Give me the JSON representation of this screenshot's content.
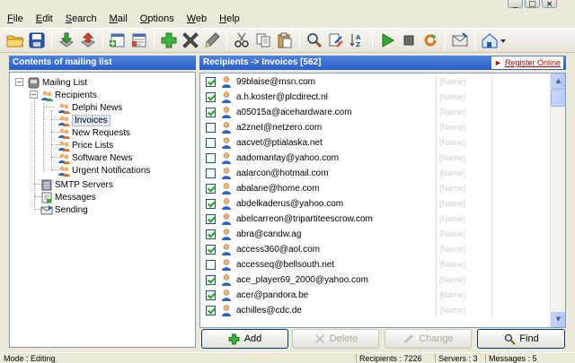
{
  "menu": {
    "items": [
      {
        "key": "F",
        "rest": "ile"
      },
      {
        "key": "E",
        "rest": "dit"
      },
      {
        "key": "S",
        "rest": "earch"
      },
      {
        "key": "M",
        "rest": "ail"
      },
      {
        "key": "O",
        "rest": "ptions"
      },
      {
        "key": "W",
        "rest": "eb"
      },
      {
        "key": "H",
        "rest": "elp"
      }
    ]
  },
  "left_panel": {
    "title": "Contents of mailing list",
    "tree": {
      "root": "Mailing List",
      "recipients": "Recipients",
      "lists": [
        "Delphi News",
        "Invoices",
        "New Requests",
        "Price Lists",
        "Software News",
        "Urgent Notifications"
      ],
      "selected": "Invoices",
      "smtp": "SMTP Servers",
      "messages": "Messages",
      "sending": "Sending"
    }
  },
  "right_panel": {
    "title": "Recipients -> Invoices [562]",
    "register_link": "Register Online",
    "recipients": [
      {
        "email": "99blaise@msn.com",
        "checked": true,
        "name": "[Name]"
      },
      {
        "email": "a.h.koster@plcdirect.nl",
        "checked": true,
        "name": "[Name]"
      },
      {
        "email": "a05015a@acehardware.com",
        "checked": true,
        "name": "[Name]"
      },
      {
        "email": "a2znet@netzero.com",
        "checked": false,
        "name": "[Name]"
      },
      {
        "email": "aacvet@ptialaska.net",
        "checked": false,
        "name": "[Name]"
      },
      {
        "email": "aadomantay@yahoo.com",
        "checked": false,
        "name": "[Name]"
      },
      {
        "email": "aalarcon@hotmail.com",
        "checked": false,
        "name": "[Name]"
      },
      {
        "email": "abalane@home.com",
        "checked": true,
        "name": "[Name]"
      },
      {
        "email": "abdelkaderus@yahoo.com",
        "checked": true,
        "name": "[Name]"
      },
      {
        "email": "abelcarreon@tripartiteescrow.com",
        "checked": true,
        "name": "[Name]"
      },
      {
        "email": "abra@candw.ag",
        "checked": true,
        "name": "[Name]"
      },
      {
        "email": "access360@aol.com",
        "checked": true,
        "name": "[Name]"
      },
      {
        "email": "accesseq@bellsouth.net",
        "checked": false,
        "name": "[Name]"
      },
      {
        "email": "ace_player69_2000@yahoo.com",
        "checked": true,
        "name": "[Name]"
      },
      {
        "email": "acer@pandora.be",
        "checked": true,
        "name": "[Name]"
      },
      {
        "email": "achilles@cdc.de",
        "checked": true,
        "name": "[Name]"
      }
    ]
  },
  "buttons": {
    "add": "Add",
    "delete": "Delete",
    "change": "Change",
    "find": "Find"
  },
  "status": {
    "mode": "Mode : Editing",
    "recipients": "Recipients : 7226",
    "servers": "Servers : 3",
    "messages": "Messages : 5"
  },
  "colors": {
    "header_blue": "#2b5ec6",
    "selection": "#316ac5",
    "register_red": "#c00000",
    "check_green": "#21a121"
  }
}
